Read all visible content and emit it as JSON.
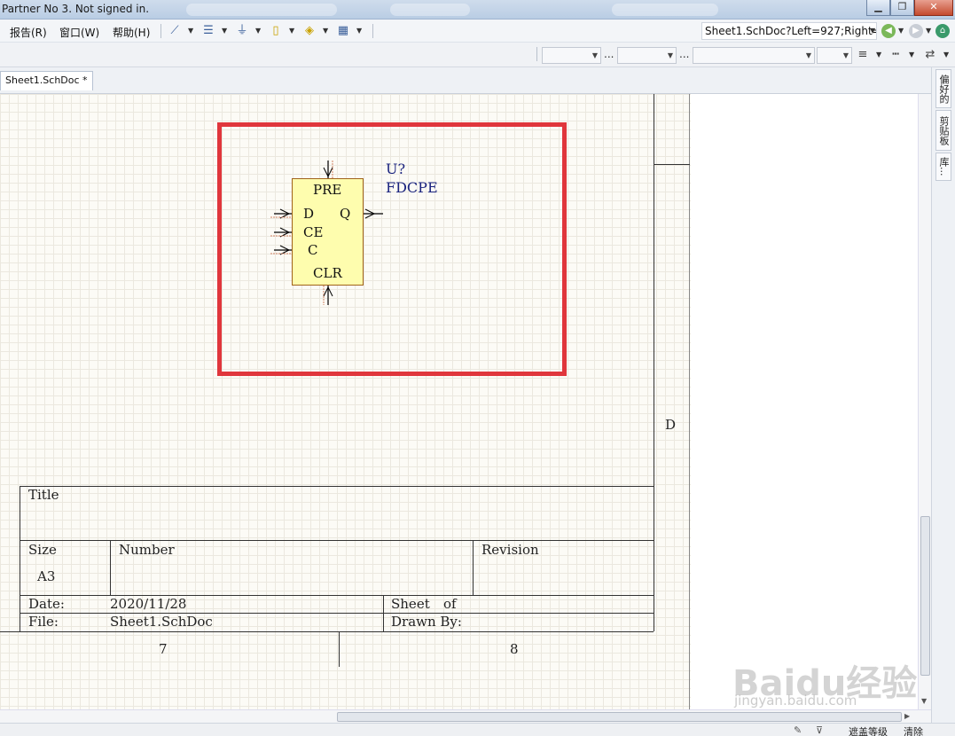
{
  "window": {
    "title": "Partner No 3. Not signed in."
  },
  "menu": {
    "report": "报告(R)",
    "window": "窗口(W)",
    "help": "帮助(H)"
  },
  "address": {
    "value": "Sheet1.SchDoc?Left=927;Right="
  },
  "toolbar2": {
    "ellipsis": "..."
  },
  "tabs": [
    {
      "label": "Sheet1.SchDoc *"
    }
  ],
  "right_dock": [
    {
      "label": "偏好的"
    },
    {
      "label": "剪贴板"
    },
    {
      "label": "库..."
    }
  ],
  "component": {
    "designator": "U?",
    "name": "FDCPE",
    "pins": {
      "pre": "PRE",
      "d": "D",
      "q": "Q",
      "ce": "CE",
      "c": "C",
      "clr": "CLR"
    }
  },
  "title_block": {
    "title_label": "Title",
    "size_label": "Size",
    "size_value": "A3",
    "number_label": "Number",
    "revision_label": "Revision",
    "date_label": "Date:",
    "date_value": "2020/11/28",
    "sheet_label": "Sheet",
    "of_label": "of",
    "file_label": "File:",
    "file_value": "Sheet1.SchDoc",
    "drawn_by_label": "Drawn By:"
  },
  "zones": {
    "col7": "7",
    "col8": "8",
    "rowD": "D"
  },
  "status": {
    "mask_level": "遮盖等级",
    "clear": "清除"
  },
  "watermark": {
    "text": "Baidu经验",
    "url": "jingyan.baidu.com"
  }
}
